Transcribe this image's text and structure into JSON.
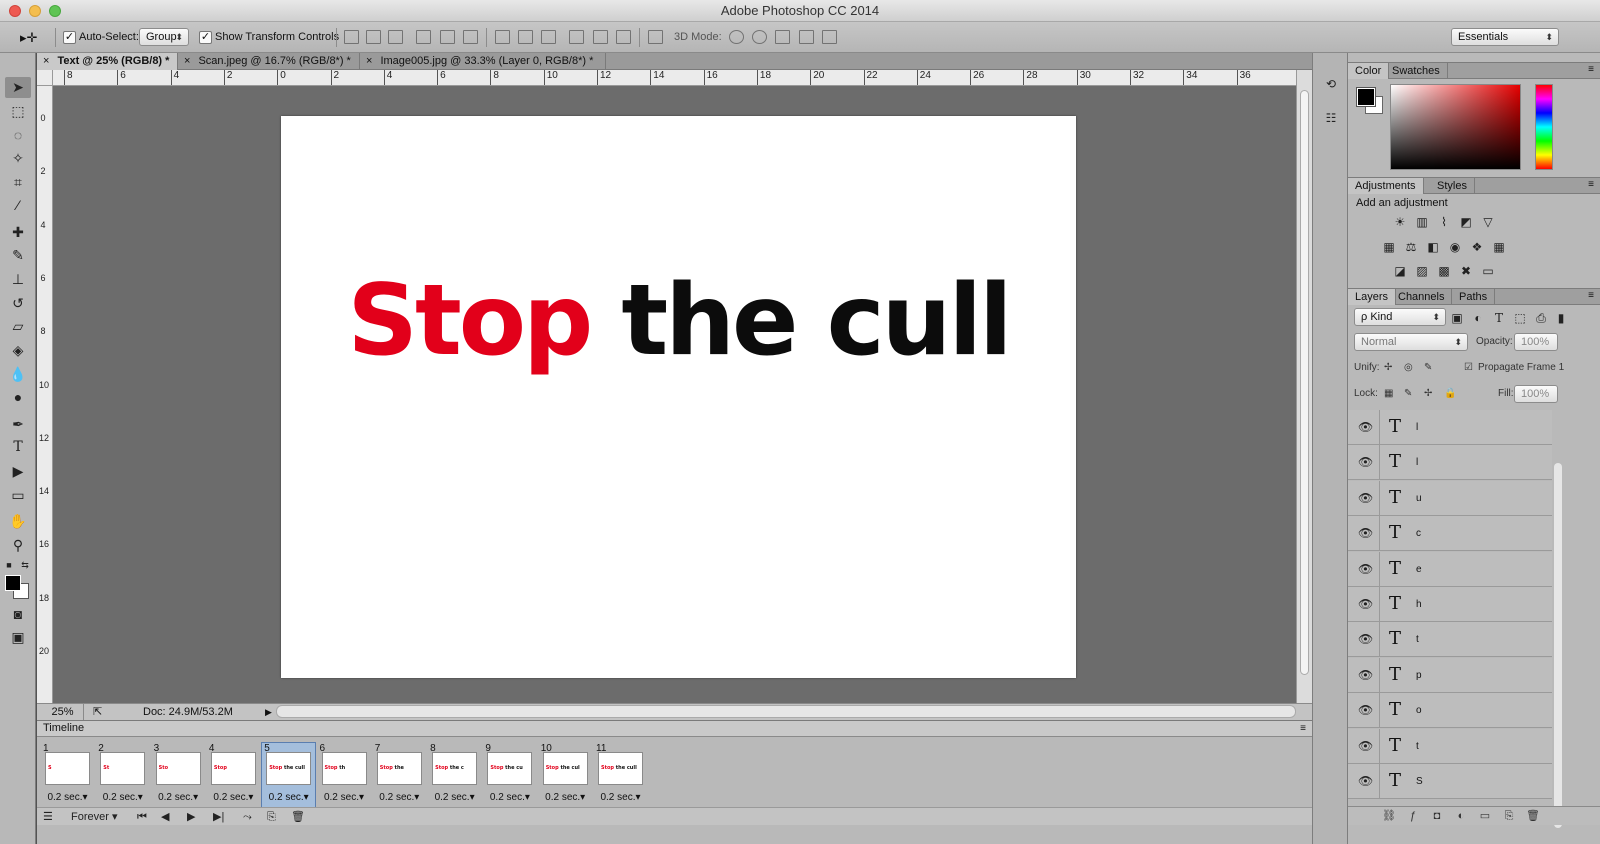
{
  "window": {
    "title": "Adobe Photoshop CC 2014"
  },
  "options_bar": {
    "move_tool_label": "▸✛",
    "auto_select_label": "Auto-Select:",
    "auto_select_checked": "✓",
    "auto_select_value": "Group",
    "transform_checked": "✓",
    "transform_label": "Show Transform Controls",
    "mode_3d_label": "3D Mode:",
    "workspace_value": "Essentials"
  },
  "doc_tabs": [
    {
      "label": "Text @ 25% (RGB/8) *",
      "close": "×"
    },
    {
      "label": "Scan.jpeg @ 16.7% (RGB/8*) *",
      "close": "×"
    },
    {
      "label": "Image005.jpg @ 33.3% (Layer 0, RGB/8*) *",
      "close": "×"
    }
  ],
  "rulers": {
    "h_labels": [
      "8",
      "6",
      "4",
      "2",
      "0",
      "2",
      "4",
      "6",
      "8",
      "10",
      "12",
      "14",
      "16",
      "18",
      "20",
      "22",
      "24",
      "26",
      "28",
      "30",
      "32",
      "34",
      "36"
    ],
    "v_labels": [
      "0",
      "2",
      "4",
      "6",
      "8",
      "10",
      "12",
      "14",
      "16",
      "18",
      "20"
    ]
  },
  "canvas": {
    "headline_red": "Stop",
    "headline_black": "the cull",
    "accent_red": "#e2001a"
  },
  "status": {
    "zoom": "25%",
    "doc": "Doc: 24.9M/53.2M",
    "arrow": "▶"
  },
  "timeline": {
    "title": "Timeline",
    "frames": [
      {
        "num": "1",
        "red": "S",
        "black": "",
        "delay": "0.2 sec.▾"
      },
      {
        "num": "2",
        "red": "St",
        "black": "",
        "delay": "0.2 sec.▾"
      },
      {
        "num": "3",
        "red": "Sto",
        "black": "",
        "delay": "0.2 sec.▾"
      },
      {
        "num": "4",
        "red": "Stop",
        "black": "",
        "delay": "0.2 sec.▾"
      },
      {
        "num": "5",
        "red": "Stop",
        "black": " the cull",
        "delay": "0.2 sec.▾"
      },
      {
        "num": "6",
        "red": "Stop",
        "black": " th",
        "delay": "0.2 sec.▾"
      },
      {
        "num": "7",
        "red": "Stop",
        "black": " the",
        "delay": "0.2 sec.▾"
      },
      {
        "num": "8",
        "red": "Stop",
        "black": " the c",
        "delay": "0.2 sec.▾"
      },
      {
        "num": "9",
        "red": "Stop",
        "black": " the cu",
        "delay": "0.2 sec.▾"
      },
      {
        "num": "10",
        "red": "Stop",
        "black": " the cul",
        "delay": "0.2 sec.▾"
      },
      {
        "num": "11",
        "red": "Stop",
        "black": " the cull",
        "delay": "0.2 sec.▾"
      }
    ],
    "loop_value": "Forever",
    "loop_arrow": "▾"
  },
  "color_panel": {
    "tab1": "Color",
    "tab2": "Swatches"
  },
  "adjustments_panel": {
    "tab1": "Adjustments",
    "tab2": "Styles",
    "subtitle": "Add an adjustment"
  },
  "layers_panel": {
    "tab1": "Layers",
    "tab2": "Channels",
    "tab3": "Paths",
    "filter_value": "ρ Kind",
    "blend_value": "Normal",
    "opacity_label": "Opacity:",
    "opacity_value": "100%",
    "unify_label": "Unify:",
    "propagate_label": "Propagate Frame 1",
    "lock_label": "Lock:",
    "fill_label": "Fill:",
    "fill_value": "100%",
    "layers": [
      "l",
      "l",
      "u",
      "c",
      "e",
      "h",
      "t",
      "p",
      "o",
      "t",
      "S"
    ]
  }
}
